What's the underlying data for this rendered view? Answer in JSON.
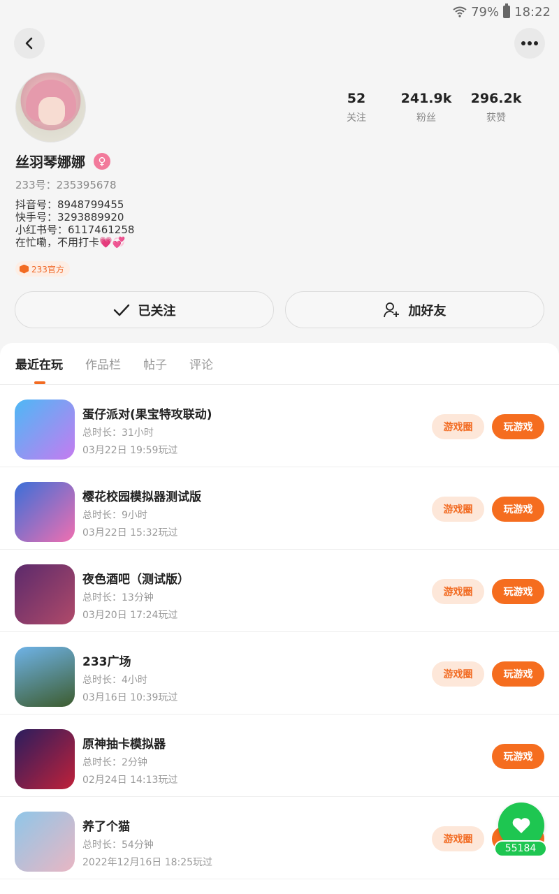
{
  "status": {
    "battery": "79%",
    "time": "18:22"
  },
  "profile": {
    "nickname": "丝羽琴娜娜",
    "gender_symbol": "♀",
    "id_line": "233号：235395678",
    "bio_lines": [
      "抖音号：8948799455",
      "快手号：3293889920",
      "小红书号：6117461258",
      "在忙嘞，不用打卡💗💞"
    ],
    "official_tag": "233官方"
  },
  "stats": [
    {
      "num": "52",
      "label": "关注"
    },
    {
      "num": "241.9k",
      "label": "粉丝"
    },
    {
      "num": "296.2k",
      "label": "获赞"
    }
  ],
  "actions": {
    "follow_label": "已关注",
    "friend_label": "加好友"
  },
  "tabs": [
    "最近在玩",
    "作品栏",
    "帖子",
    "评论"
  ],
  "buttons": {
    "circle": "游戏圈",
    "play": "玩游戏"
  },
  "games": [
    {
      "name": "蛋仔派对(果宝特攻联动)",
      "duration": "总时长：31小时",
      "last_played": "03月22日 19:59玩过",
      "has_circle": true,
      "icon_colors": [
        "#4db8f5",
        "#c57bf0"
      ]
    },
    {
      "name": "樱花校园模拟器测试版",
      "duration": "总时长：9小时",
      "last_played": "03月22日 15:32玩过",
      "has_circle": true,
      "icon_colors": [
        "#3a6fd8",
        "#f06fb0"
      ]
    },
    {
      "name": "夜色酒吧（测试版）",
      "duration": "总时长：13分钟",
      "last_played": "03月20日 17:24玩过",
      "has_circle": true,
      "icon_colors": [
        "#5b2a6b",
        "#b04a6a"
      ]
    },
    {
      "name": "233广场",
      "duration": "总时长：4小时",
      "last_played": "03月16日 10:39玩过",
      "has_circle": true,
      "icon_colors": [
        "#6fb3e8",
        "#3d5c2e"
      ]
    },
    {
      "name": "原神抽卡模拟器",
      "duration": "总时长：2分钟",
      "last_played": "02月24日 14:13玩过",
      "has_circle": false,
      "icon_colors": [
        "#2a1d5e",
        "#c0213a"
      ]
    },
    {
      "name": "养了个猫",
      "duration": "总时长：54分钟",
      "last_played": "2022年12月16日 18:25玩过",
      "has_circle": true,
      "icon_colors": [
        "#8fc6e8",
        "#e9b6c3"
      ]
    }
  ],
  "float_count": "55184"
}
